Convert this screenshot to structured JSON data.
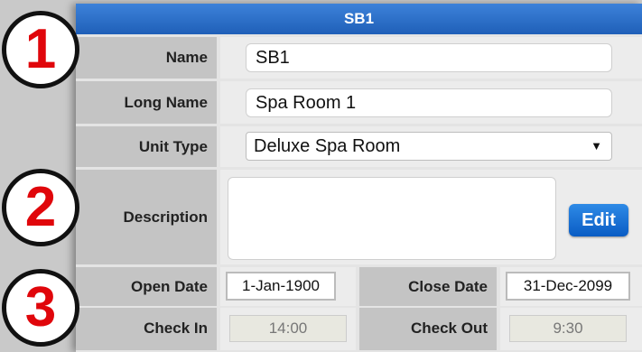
{
  "header": {
    "title": "SB1"
  },
  "fields": {
    "name": {
      "label": "Name",
      "value": "SB1"
    },
    "long_name": {
      "label": "Long Name",
      "value": "Spa Room 1"
    },
    "unit_type": {
      "label": "Unit Type",
      "value": "Deluxe Spa Room",
      "caret": "▼"
    },
    "description": {
      "label": "Description",
      "value": "",
      "edit_label": "Edit"
    }
  },
  "dates": {
    "open_label": "Open Date",
    "open_value": "1-Jan-1900",
    "close_label": "Close Date",
    "close_value": "31-Dec-2099"
  },
  "times": {
    "checkin_label": "Check In",
    "checkin_value": "14:00",
    "checkout_label": "Check Out",
    "checkout_value": "9:30"
  },
  "markers": [
    "1",
    "2",
    "3"
  ],
  "colors": {
    "header": "#2a6fc9",
    "marker_number": "#e0060b",
    "edit_button": "#1a6fd6"
  }
}
